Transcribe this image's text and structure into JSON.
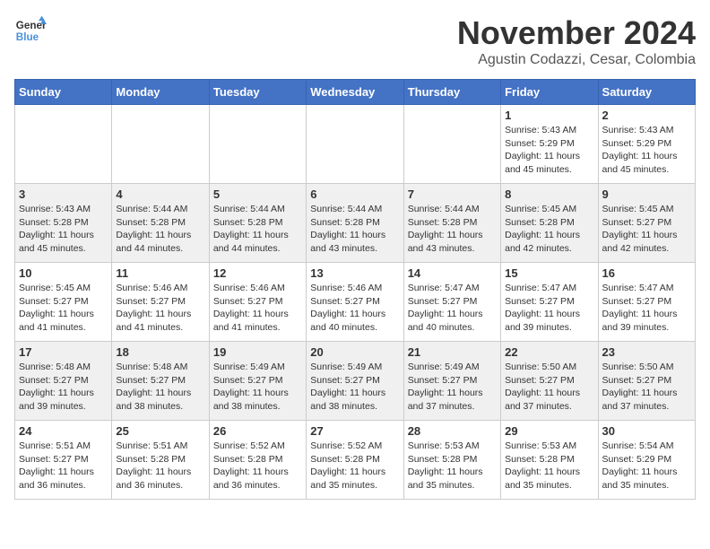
{
  "logo": {
    "line1": "General",
    "line2": "Blue"
  },
  "title": "November 2024",
  "subtitle": "Agustin Codazzi, Cesar, Colombia",
  "days_of_week": [
    "Sunday",
    "Monday",
    "Tuesday",
    "Wednesday",
    "Thursday",
    "Friday",
    "Saturday"
  ],
  "weeks": [
    [
      {
        "day": "",
        "info": ""
      },
      {
        "day": "",
        "info": ""
      },
      {
        "day": "",
        "info": ""
      },
      {
        "day": "",
        "info": ""
      },
      {
        "day": "",
        "info": ""
      },
      {
        "day": "1",
        "info": "Sunrise: 5:43 AM\nSunset: 5:29 PM\nDaylight: 11 hours and 45 minutes."
      },
      {
        "day": "2",
        "info": "Sunrise: 5:43 AM\nSunset: 5:29 PM\nDaylight: 11 hours and 45 minutes."
      }
    ],
    [
      {
        "day": "3",
        "info": "Sunrise: 5:43 AM\nSunset: 5:28 PM\nDaylight: 11 hours and 45 minutes."
      },
      {
        "day": "4",
        "info": "Sunrise: 5:44 AM\nSunset: 5:28 PM\nDaylight: 11 hours and 44 minutes."
      },
      {
        "day": "5",
        "info": "Sunrise: 5:44 AM\nSunset: 5:28 PM\nDaylight: 11 hours and 44 minutes."
      },
      {
        "day": "6",
        "info": "Sunrise: 5:44 AM\nSunset: 5:28 PM\nDaylight: 11 hours and 43 minutes."
      },
      {
        "day": "7",
        "info": "Sunrise: 5:44 AM\nSunset: 5:28 PM\nDaylight: 11 hours and 43 minutes."
      },
      {
        "day": "8",
        "info": "Sunrise: 5:45 AM\nSunset: 5:28 PM\nDaylight: 11 hours and 42 minutes."
      },
      {
        "day": "9",
        "info": "Sunrise: 5:45 AM\nSunset: 5:27 PM\nDaylight: 11 hours and 42 minutes."
      }
    ],
    [
      {
        "day": "10",
        "info": "Sunrise: 5:45 AM\nSunset: 5:27 PM\nDaylight: 11 hours and 41 minutes."
      },
      {
        "day": "11",
        "info": "Sunrise: 5:46 AM\nSunset: 5:27 PM\nDaylight: 11 hours and 41 minutes."
      },
      {
        "day": "12",
        "info": "Sunrise: 5:46 AM\nSunset: 5:27 PM\nDaylight: 11 hours and 41 minutes."
      },
      {
        "day": "13",
        "info": "Sunrise: 5:46 AM\nSunset: 5:27 PM\nDaylight: 11 hours and 40 minutes."
      },
      {
        "day": "14",
        "info": "Sunrise: 5:47 AM\nSunset: 5:27 PM\nDaylight: 11 hours and 40 minutes."
      },
      {
        "day": "15",
        "info": "Sunrise: 5:47 AM\nSunset: 5:27 PM\nDaylight: 11 hours and 39 minutes."
      },
      {
        "day": "16",
        "info": "Sunrise: 5:47 AM\nSunset: 5:27 PM\nDaylight: 11 hours and 39 minutes."
      }
    ],
    [
      {
        "day": "17",
        "info": "Sunrise: 5:48 AM\nSunset: 5:27 PM\nDaylight: 11 hours and 39 minutes."
      },
      {
        "day": "18",
        "info": "Sunrise: 5:48 AM\nSunset: 5:27 PM\nDaylight: 11 hours and 38 minutes."
      },
      {
        "day": "19",
        "info": "Sunrise: 5:49 AM\nSunset: 5:27 PM\nDaylight: 11 hours and 38 minutes."
      },
      {
        "day": "20",
        "info": "Sunrise: 5:49 AM\nSunset: 5:27 PM\nDaylight: 11 hours and 38 minutes."
      },
      {
        "day": "21",
        "info": "Sunrise: 5:49 AM\nSunset: 5:27 PM\nDaylight: 11 hours and 37 minutes."
      },
      {
        "day": "22",
        "info": "Sunrise: 5:50 AM\nSunset: 5:27 PM\nDaylight: 11 hours and 37 minutes."
      },
      {
        "day": "23",
        "info": "Sunrise: 5:50 AM\nSunset: 5:27 PM\nDaylight: 11 hours and 37 minutes."
      }
    ],
    [
      {
        "day": "24",
        "info": "Sunrise: 5:51 AM\nSunset: 5:27 PM\nDaylight: 11 hours and 36 minutes."
      },
      {
        "day": "25",
        "info": "Sunrise: 5:51 AM\nSunset: 5:28 PM\nDaylight: 11 hours and 36 minutes."
      },
      {
        "day": "26",
        "info": "Sunrise: 5:52 AM\nSunset: 5:28 PM\nDaylight: 11 hours and 36 minutes."
      },
      {
        "day": "27",
        "info": "Sunrise: 5:52 AM\nSunset: 5:28 PM\nDaylight: 11 hours and 35 minutes."
      },
      {
        "day": "28",
        "info": "Sunrise: 5:53 AM\nSunset: 5:28 PM\nDaylight: 11 hours and 35 minutes."
      },
      {
        "day": "29",
        "info": "Sunrise: 5:53 AM\nSunset: 5:28 PM\nDaylight: 11 hours and 35 minutes."
      },
      {
        "day": "30",
        "info": "Sunrise: 5:54 AM\nSunset: 5:29 PM\nDaylight: 11 hours and 35 minutes."
      }
    ]
  ]
}
